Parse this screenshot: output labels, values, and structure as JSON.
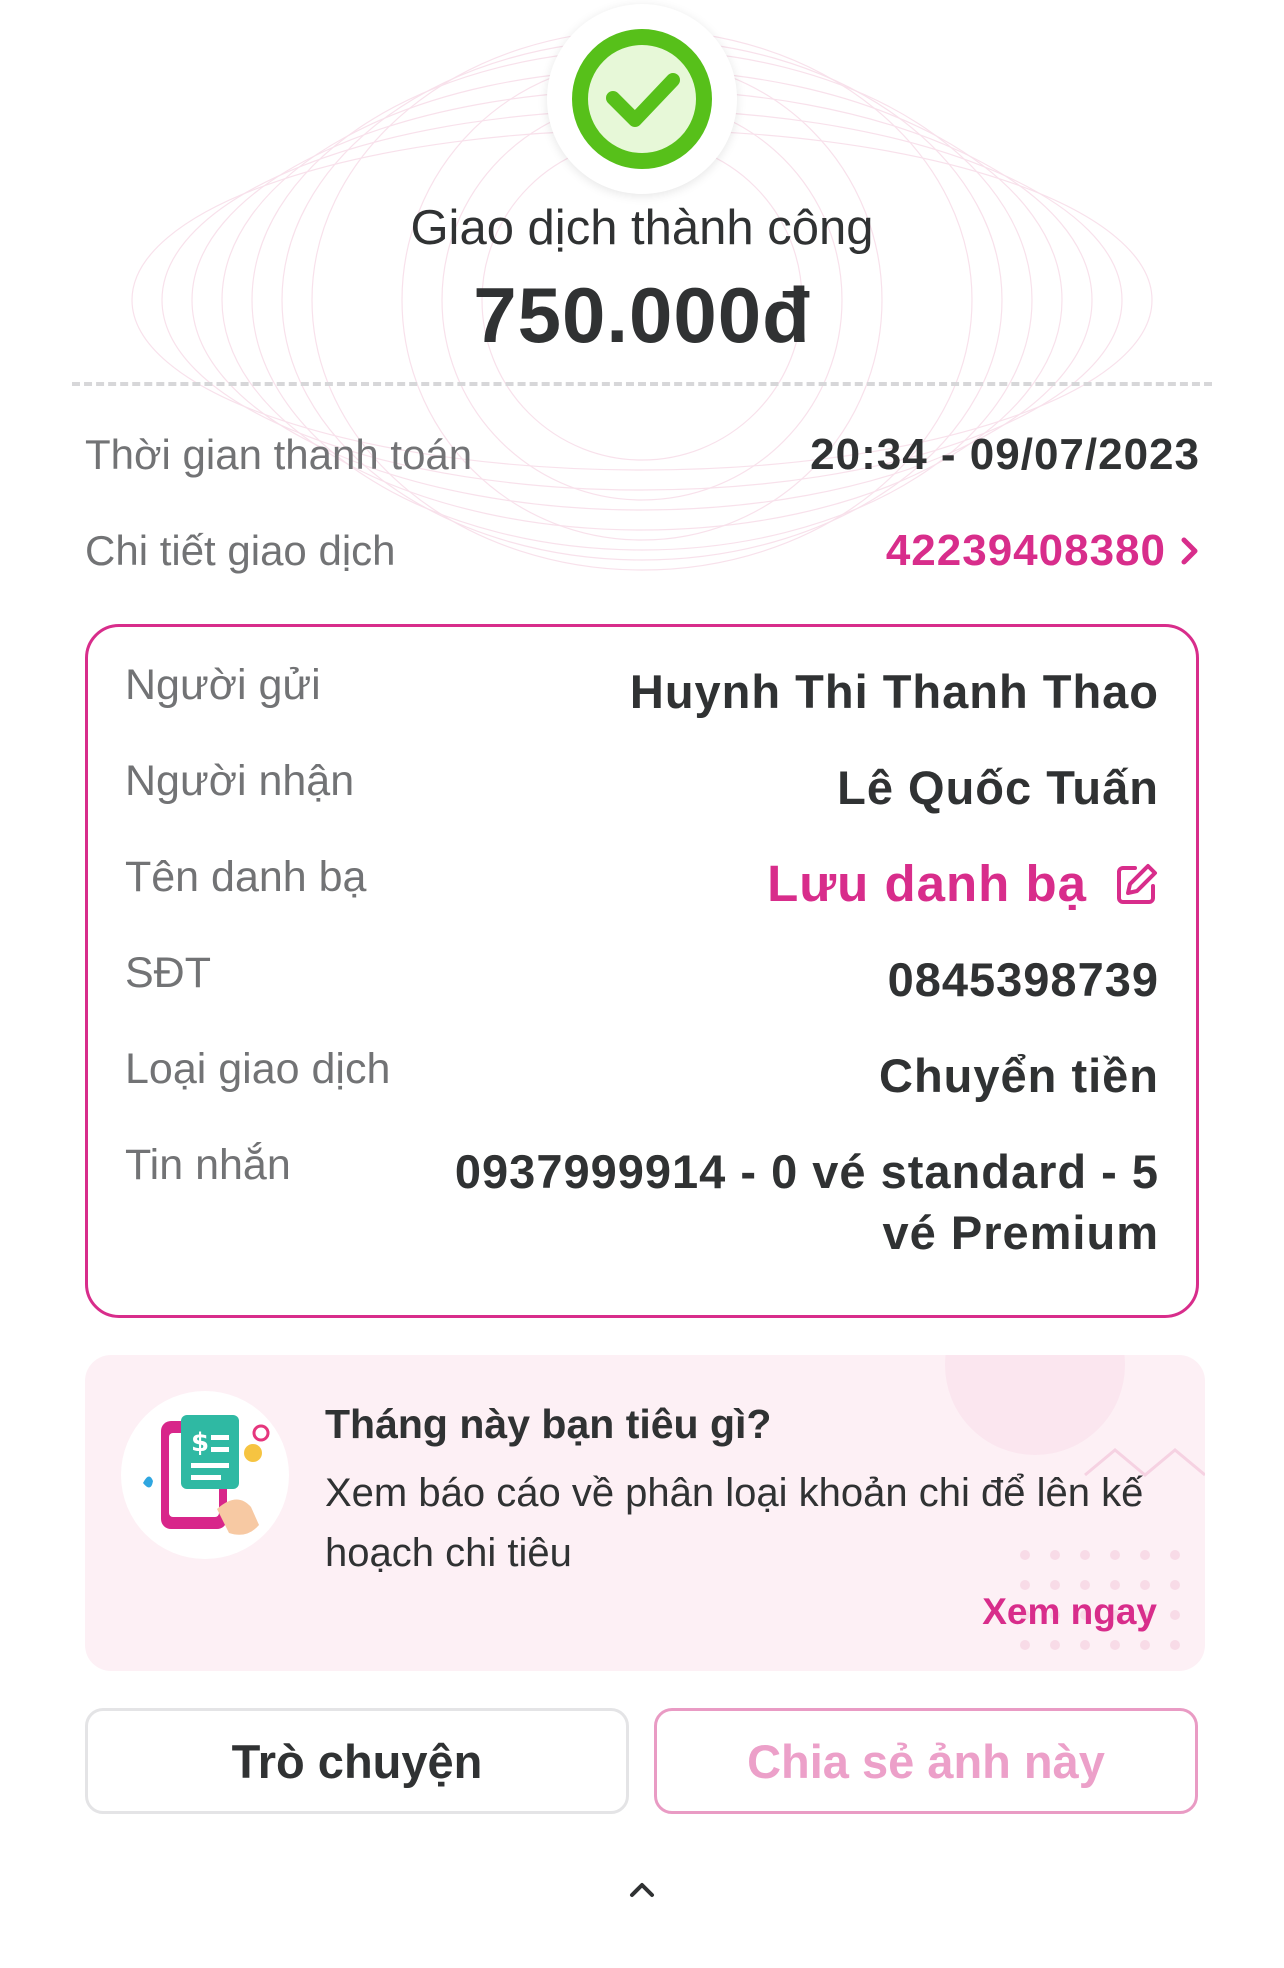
{
  "status": {
    "title": "Giao dịch thành công",
    "amount": "750.000đ"
  },
  "summary": {
    "time_label": "Thời gian thanh toán",
    "time_value": "20:34 - 09/07/2023",
    "detail_label": "Chi tiết giao dịch",
    "detail_value": "42239408380"
  },
  "details": {
    "sender_label": "Người gửi",
    "sender_value": "Huynh Thi Thanh Thao",
    "receiver_label": "Người nhận",
    "receiver_value": "Lê Quốc Tuấn",
    "contact_label": "Tên danh bạ",
    "contact_value": "Lưu danh bạ",
    "phone_label": "SĐT",
    "phone_value": "0845398739",
    "type_label": "Loại giao dịch",
    "type_value": "Chuyển tiền",
    "message_label": "Tin nhắn",
    "message_value": "0937999914 - 0 vé standard - 5 vé Premium"
  },
  "promo": {
    "title": "Tháng này bạn tiêu gì?",
    "description": "Xem báo cáo về phân loại khoản chi để lên kế hoạch chi tiêu",
    "link": "Xem ngay"
  },
  "actions": {
    "chat_label": "Trò chuyện",
    "share_label": "Chia sẻ ảnh này"
  },
  "colors": {
    "accent": "#d82d8b",
    "success": "#57c01a",
    "text": "#303233",
    "muted": "#727375"
  },
  "icons": [
    "check-circle-icon",
    "chevron-right-icon",
    "edit-icon",
    "expense-report-icon",
    "chevron-up-icon"
  ]
}
